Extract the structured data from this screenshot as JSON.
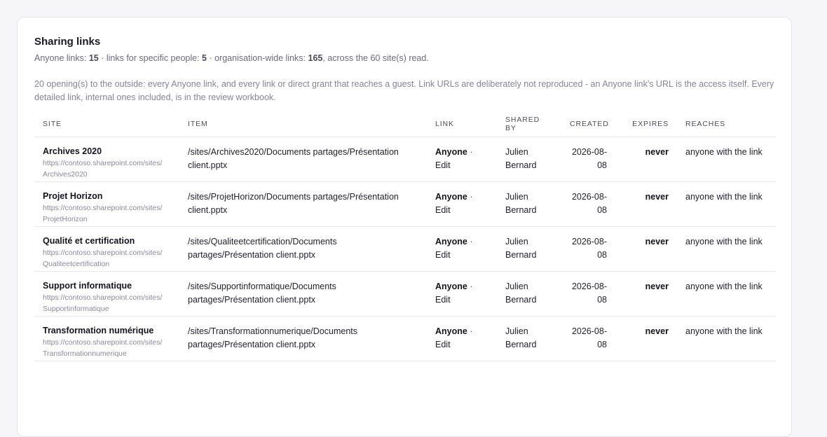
{
  "panel": {
    "title": "Sharing links",
    "summary": {
      "anyone_label": "Anyone links: ",
      "anyone_count": "15",
      "specific_label": " · links for specific people: ",
      "specific_count": "5",
      "org_label": " · organisation-wide links: ",
      "org_count": "165",
      "tail": ", across the 60 site(s) read."
    },
    "note": "20 opening(s) to the outside: every Anyone link, and every link or direct grant that reaches a guest. Link URLs are deliberately not reproduced - an Anyone link's URL is the access itself. Every detailed link, internal ones included, is in the review workbook."
  },
  "table": {
    "columns": {
      "site": "SITE",
      "item": "ITEM",
      "link": "LINK",
      "shared_by": "SHARED BY",
      "created": "CREATED",
      "expires": "EXPIRES",
      "reaches": "REACHES"
    },
    "rows": [
      {
        "site_name": "Archives 2020",
        "site_url_1": "https://contoso.sharepoint.com/sites/",
        "site_url_2": "Archives2020",
        "item": "/sites/Archives2020/Documents partages/Présentation client.pptx",
        "link_kind": "Anyone",
        "link_sep": " · ",
        "link_perm": "Edit",
        "shared_by": "Julien Bernard",
        "created": "2026-08-08",
        "expires": "never",
        "reaches": "anyone with the link"
      },
      {
        "site_name": "Projet Horizon",
        "site_url_1": "https://contoso.sharepoint.com/sites/",
        "site_url_2": "ProjetHorizon",
        "item": "/sites/ProjetHorizon/Documents partages/Présentation client.pptx",
        "link_kind": "Anyone",
        "link_sep": " · ",
        "link_perm": "Edit",
        "shared_by": "Julien Bernard",
        "created": "2026-08-08",
        "expires": "never",
        "reaches": "anyone with the link"
      },
      {
        "site_name": "Qualité et certification",
        "site_url_1": "https://contoso.sharepoint.com/sites/",
        "site_url_2": "Qualiteetcertification",
        "item": "/sites/Qualiteetcertification/Documents partages/Présentation client.pptx",
        "link_kind": "Anyone",
        "link_sep": " · ",
        "link_perm": "Edit",
        "shared_by": "Julien Bernard",
        "created": "2026-08-08",
        "expires": "never",
        "reaches": "anyone with the link"
      },
      {
        "site_name": "Support informatique",
        "site_url_1": "https://contoso.sharepoint.com/sites/",
        "site_url_2": "Supportinformatique",
        "item": "/sites/Supportinformatique/Documents partages/Présentation client.pptx",
        "link_kind": "Anyone",
        "link_sep": " · ",
        "link_perm": "Edit",
        "shared_by": "Julien Bernard",
        "created": "2026-08-08",
        "expires": "never",
        "reaches": "anyone with the link"
      },
      {
        "site_name": "Transformation numérique",
        "site_url_1": "https://contoso.sharepoint.com/sites/",
        "site_url_2": "Transformationnumerique",
        "item": "/sites/Transformationnumerique/Documents partages/Présentation client.pptx",
        "link_kind": "Anyone",
        "link_sep": " · ",
        "link_perm": "Edit",
        "shared_by": "Julien Bernard",
        "created": "2026-08-08",
        "expires": "never",
        "reaches": "anyone with the link"
      }
    ]
  }
}
